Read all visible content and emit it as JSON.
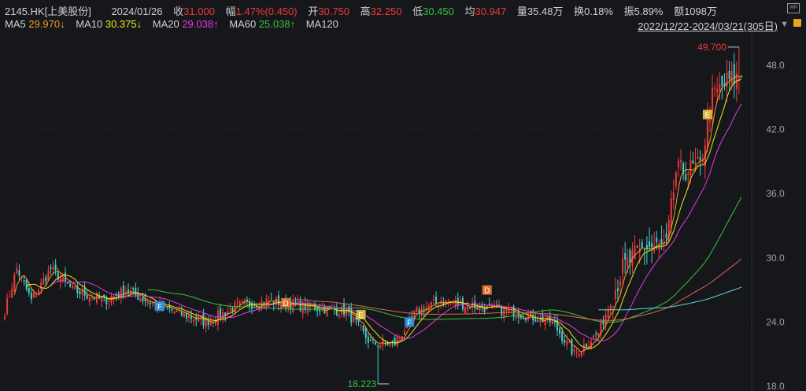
{
  "header": {
    "symbol": "2145.HK[上美股份]",
    "date": "2024/01/26",
    "close_label": "收",
    "close": "31.000",
    "change_label": "幅",
    "change": "1.47%(0.450)",
    "open_label": "开",
    "open": "30.750",
    "high_label": "高",
    "high": "32.250",
    "low_label": "低",
    "low": "30.450",
    "avg_label": "均",
    "avg": "30.947",
    "volume": "量35.48万",
    "turnover": "换0.18%",
    "amplitude": "振5.89%",
    "amount": "额1098万",
    "range": "2022/12/22-2024/03/21(305日)"
  },
  "ma": {
    "ma5_label": "MA5",
    "ma5": "29.970↓",
    "ma10_label": "MA10",
    "ma10": "30.375↓",
    "ma20_label": "MA20",
    "ma20": "29.038↑",
    "ma60_label": "MA60",
    "ma60": "25.038↑",
    "ma120_label": "MA120"
  },
  "colors": {
    "up": "#f0393a",
    "down": "#3fd0d0",
    "ma5": "#f39b1e",
    "ma10": "#e8e81e",
    "ma20": "#e33be3",
    "ma60": "#38c23a",
    "ma120": "#d86a50",
    "ma250": "#5bd5e0"
  },
  "chart_data": {
    "type": "candlestick",
    "days": 305,
    "ylim": [
      18,
      50.5
    ],
    "y_ticks": [
      "48.0",
      "42.0",
      "36.0",
      "30.0",
      "24.0",
      "18.0"
    ],
    "y_tick_values": [
      48,
      42,
      36,
      30,
      24,
      18
    ],
    "close_keypoints": [
      [
        0,
        25
      ],
      [
        5,
        29
      ],
      [
        11,
        26
      ],
      [
        19,
        29
      ],
      [
        28,
        27
      ],
      [
        41,
        26
      ],
      [
        50,
        27
      ],
      [
        63,
        25.5
      ],
      [
        83,
        24
      ],
      [
        96,
        25.5
      ],
      [
        109,
        26
      ],
      [
        122,
        25.5
      ],
      [
        141,
        25
      ],
      [
        151,
        22
      ],
      [
        161,
        22
      ],
      [
        170,
        25
      ],
      [
        180,
        26
      ],
      [
        193,
        25.5
      ],
      [
        209,
        25
      ],
      [
        226,
        24
      ],
      [
        235,
        21
      ],
      [
        245,
        23
      ],
      [
        255,
        29
      ],
      [
        264,
        31
      ],
      [
        273,
        31
      ],
      [
        277,
        38
      ],
      [
        287,
        38.5
      ],
      [
        292,
        45
      ],
      [
        298,
        46.5
      ],
      [
        304,
        47
      ]
    ],
    "max_label": "49.700",
    "max_value": 49.7,
    "max_day": 303,
    "min_label": "18.223",
    "min_value": 18.223,
    "min_day": 154,
    "events": [
      {
        "label": "F",
        "day": 64,
        "price": 25.5,
        "color": "#2a8fd8"
      },
      {
        "label": "D",
        "day": 116,
        "price": 25.8,
        "color": "#e0702a"
      },
      {
        "label": "E",
        "day": 147,
        "price": 24.7,
        "color": "#d8b43a"
      },
      {
        "label": "F",
        "day": 167,
        "price": 24.0,
        "color": "#2a8fd8"
      },
      {
        "label": "D",
        "day": 199,
        "price": 27.0,
        "color": "#e0702a"
      },
      {
        "label": "E",
        "day": 290,
        "price": 43.4,
        "color": "#d8b43a"
      }
    ]
  }
}
